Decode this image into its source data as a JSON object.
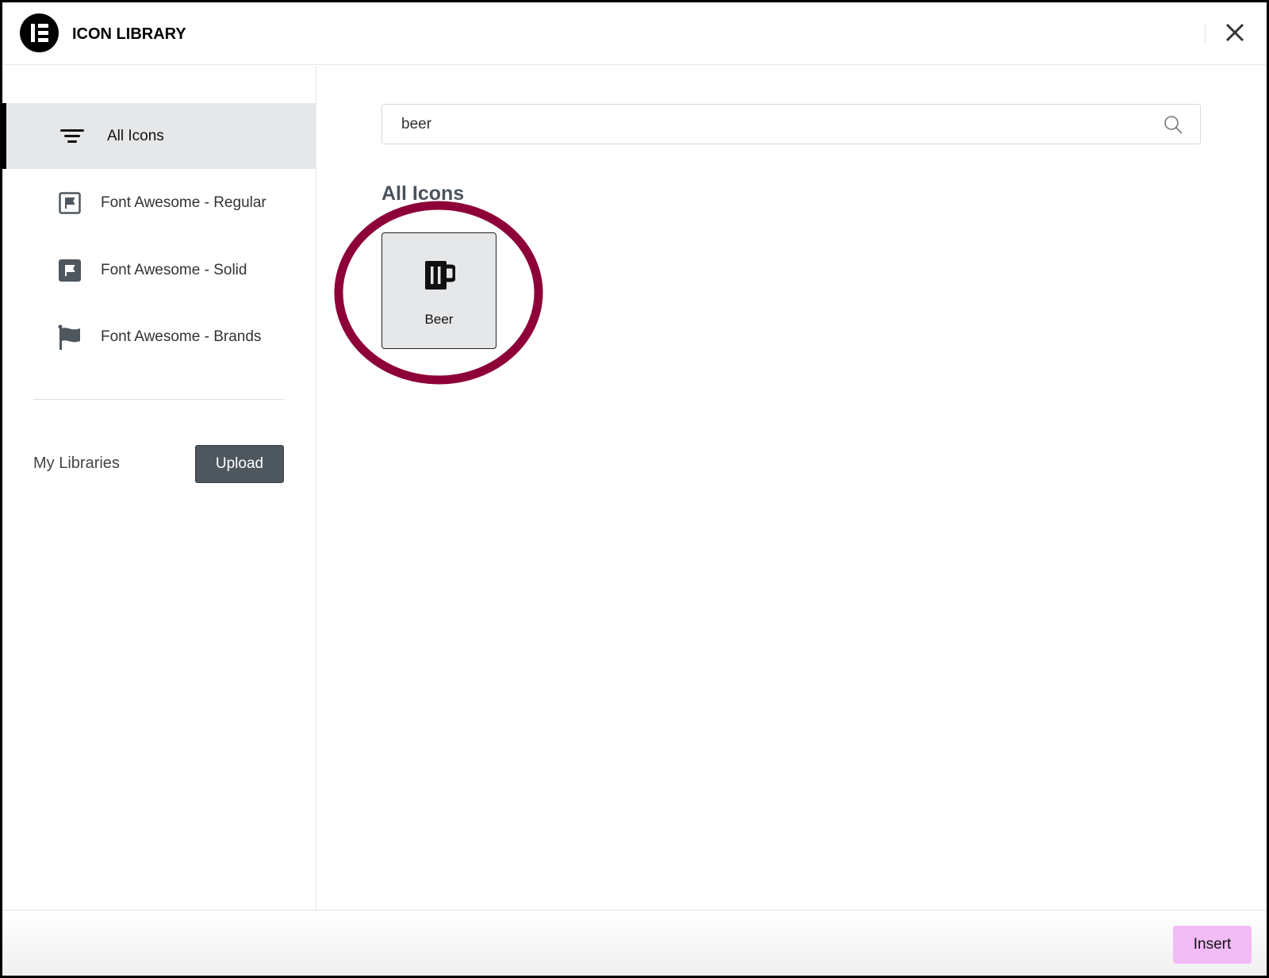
{
  "header": {
    "title": "ICON LIBRARY",
    "logo": "elementor-logo",
    "close_icon": "close-icon"
  },
  "sidebar": {
    "items": [
      {
        "label": "All Icons",
        "icon": "filter-icon",
        "active": true
      },
      {
        "label": "Font Awesome - Regular",
        "icon": "flag-regular-icon"
      },
      {
        "label": "Font Awesome - Solid",
        "icon": "flag-solid-icon"
      },
      {
        "label": "Font Awesome - Brands",
        "icon": "flag-brands-icon"
      }
    ],
    "my_libraries": "My Libraries",
    "upload_label": "Upload"
  },
  "main": {
    "search": {
      "value": "beer",
      "icon": "search-icon"
    },
    "section_title": "All Icons",
    "icons": [
      {
        "label": "Beer",
        "icon": "beer-icon",
        "selected": true
      }
    ],
    "highlight_color": "#8e0038"
  },
  "footer": {
    "insert_label": "Insert",
    "insert_color": "#f1bbf5"
  }
}
